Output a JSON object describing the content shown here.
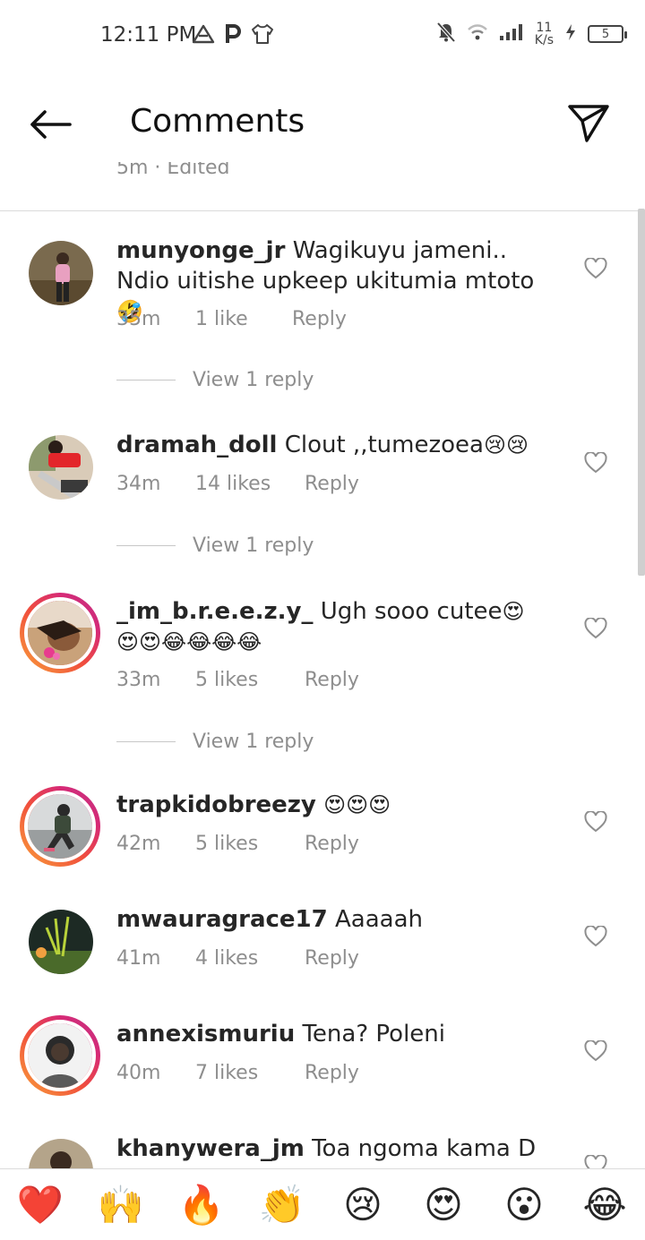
{
  "status_bar": {
    "time": "12:11 PM",
    "net_speed_top": "11",
    "net_speed_bottom": "K/s",
    "battery": "5"
  },
  "header": {
    "title": "Comments"
  },
  "scrolled_caption": "5m · Edited",
  "comments": [
    {
      "username": "munyonge_jr",
      "text": "Wagikuyu jameni.. Ndio uitishe upkeep ukitumia mtoto",
      "emoji": "🤣",
      "time": "35m",
      "likes": "1 like",
      "reply": "Reply",
      "view_replies": "View 1 reply"
    },
    {
      "username": "dramah_doll",
      "text": "Clout ,,tumezoea",
      "emoji": "😢😢",
      "time": "34m",
      "likes": "14 likes",
      "reply": "Reply",
      "view_replies": "View 1 reply"
    },
    {
      "username": "_im_b.r.e.e.z.y_",
      "text": "Ugh sooo cutee",
      "emoji": "😍😍😍😂😂😂😂",
      "time": "33m",
      "likes": "5 likes",
      "reply": "Reply",
      "view_replies": "View 1 reply"
    },
    {
      "username": "trapkidobreezy",
      "text": "",
      "emoji": "😍😍😍",
      "time": "42m",
      "likes": "5 likes",
      "reply": "Reply"
    },
    {
      "username": "mwauragrace17",
      "text": "Aaaaah",
      "emoji": "",
      "time": "41m",
      "likes": "4 likes",
      "reply": "Reply"
    },
    {
      "username": "annexismuriu",
      "text": "Tena? Poleni",
      "emoji": "",
      "time": "40m",
      "likes": "7 likes",
      "reply": "Reply"
    },
    {
      "username": "khanywera_jm",
      "text": "Toa ngoma kama D",
      "emoji": ""
    }
  ],
  "reactions": [
    "❤️",
    "🙌",
    "🔥",
    "👏",
    "😢",
    "😍",
    "😮",
    "😂"
  ],
  "colors": {
    "story_ring_start": "#f9a13a",
    "story_ring_end": "#c13584",
    "secondary_text": "#8e8e8e",
    "primary_text": "#262626"
  }
}
